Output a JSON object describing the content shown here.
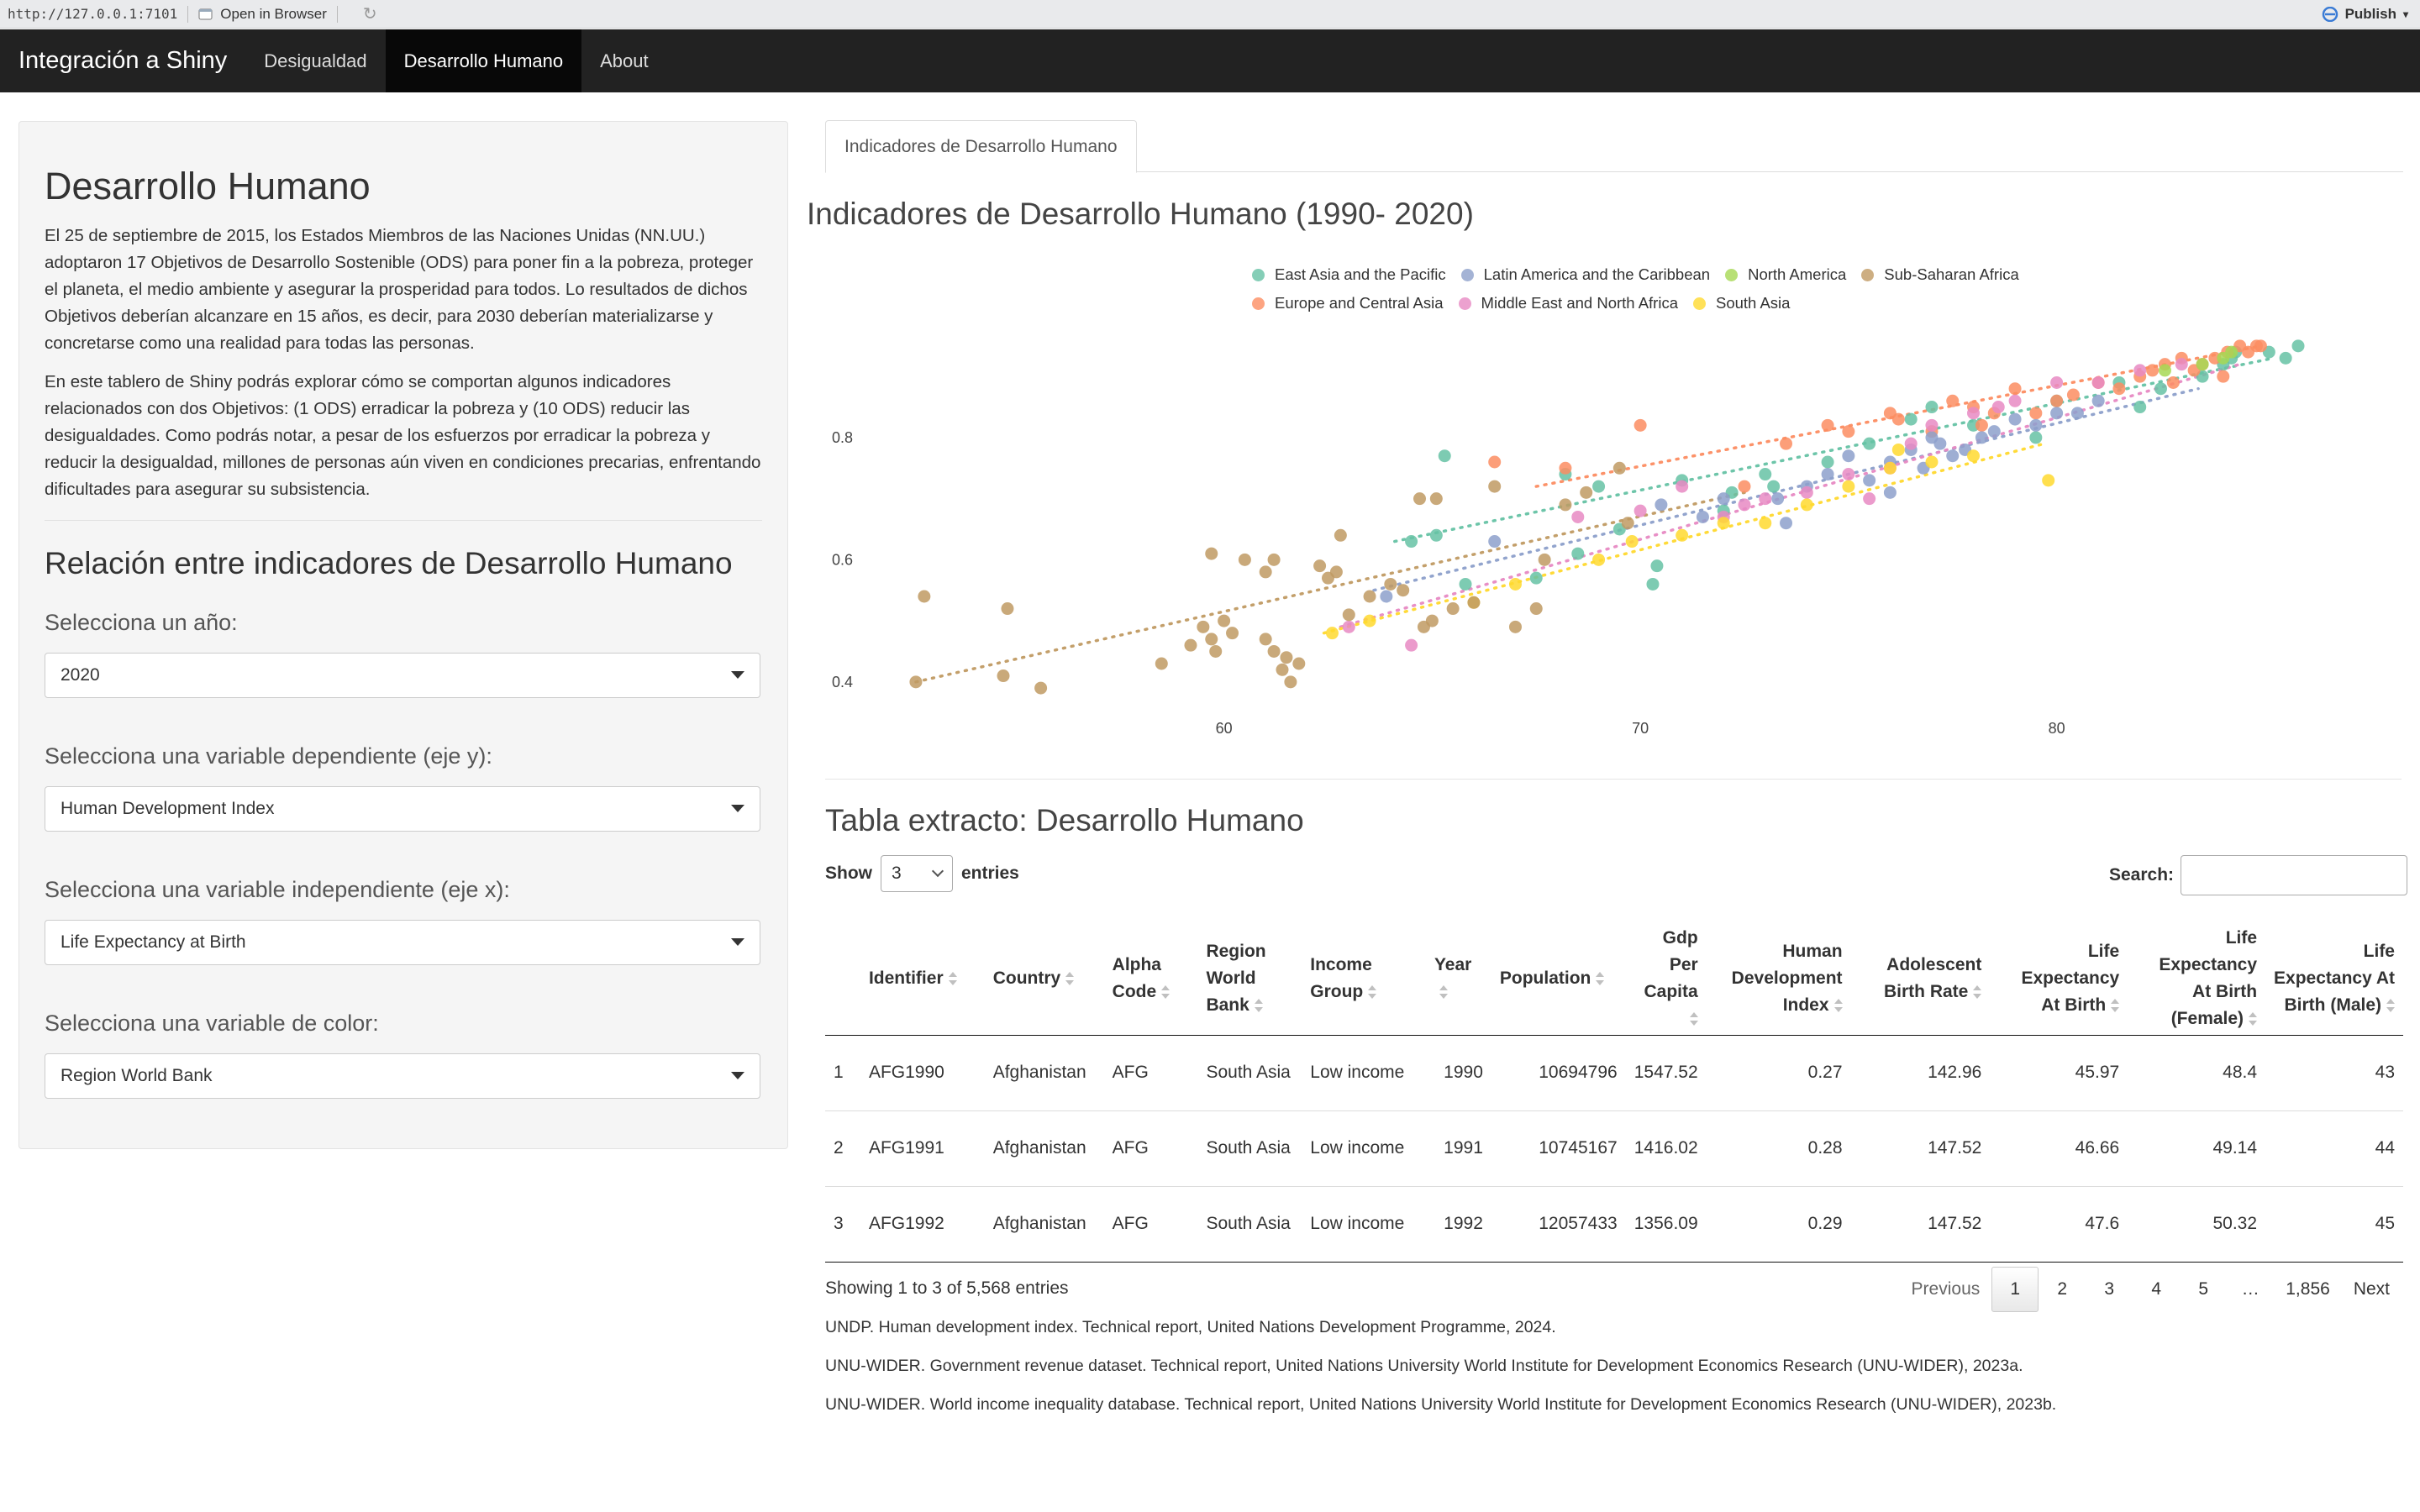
{
  "viewer": {
    "url": "http://127.0.0.1:7101",
    "open_label": "Open in Browser",
    "publish_label": "Publish"
  },
  "navbar": {
    "brand": "Integración a Shiny",
    "items": [
      {
        "label": "Desigualdad",
        "active": false
      },
      {
        "label": "Desarrollo Humano",
        "active": true
      },
      {
        "label": "About",
        "active": false
      }
    ]
  },
  "sidebar": {
    "title": "Desarrollo Humano",
    "para1": "El 25 de septiembre de 2015, los Estados Miembros de las Naciones Unidas (NN.UU.) adoptaron 17 Objetivos de Desarrollo Sostenible (ODS) para poner fin a la pobreza, proteger el planeta, el medio ambiente y asegurar la prosperidad para todos. Lo resultados de dichos Objetivos deberían alcanzare en 15 años, es decir, para 2030 deberían materializarse y concretarse como una realidad para todas las personas.",
    "para2": "En este tablero de Shiny podrás explorar cómo se comportan algunos indicadores relacionados con dos Objetivos: (1 ODS) erradicar la pobreza y (10 ODS) reducir las desigualdades. Como podrás notar, a pesar de los esfuerzos por erradicar la pobreza y reducir la desigualdad, millones de personas aún viven en condiciones precarias, enfrentando dificultades para asegurar su subsistencia.",
    "section_title": "Relación entre indicadores de Desarrollo Humano",
    "controls": [
      {
        "label": "Selecciona un año:",
        "value": "2020"
      },
      {
        "label": "Selecciona una variable dependiente (eje y):",
        "value": "Human Development Index"
      },
      {
        "label": "Selecciona una variable independiente (eje x):",
        "value": "Life Expectancy at Birth"
      },
      {
        "label": "Selecciona una variable de color:",
        "value": "Region World Bank"
      }
    ]
  },
  "main": {
    "tab_label": "Indicadores de Desarrollo Humano",
    "plot_title": "Indicadores de Desarrollo Humano (1990- 2020)",
    "table_title": "Tabla extracto: Desarrollo Humano",
    "show_label": "Show",
    "entries_value": "3",
    "entries_label": "entries",
    "search_label": "Search:",
    "info": "Showing 1 to 3 of 5,568 entries",
    "pager": [
      "Previous",
      "1",
      "2",
      "3",
      "4",
      "5",
      "…",
      "1,856",
      "Next"
    ],
    "references": [
      "UNDP. Human development index. Technical report, United Nations Development Programme, 2024.",
      "UNU-WIDER. Government revenue dataset. Technical report, United Nations University World Institute for Development Economics Research (UNU-WIDER), 2023a.",
      "UNU-WIDER. World income inequality database. Technical report, United Nations University World Institute for Development Economics Research (UNU-WIDER), 2023b."
    ]
  },
  "table": {
    "columns": [
      "",
      "Identifier",
      "Country",
      "Alpha Code",
      "Region World Bank",
      "Income Group",
      "Year",
      "Population",
      "Gdp Per Capita",
      "Human Development Index",
      "Adolescent Birth Rate",
      "Life Expectancy At Birth",
      "Life Expectancy At Birth (Female)",
      "Life Expectancy At Birth (Male)"
    ],
    "rows": [
      [
        "1",
        "AFG1990",
        "Afghanistan",
        "AFG",
        "South Asia",
        "Low income",
        "1990",
        "10694796",
        "1547.52",
        "0.27",
        "142.96",
        "45.97",
        "48.4",
        "43"
      ],
      [
        "2",
        "AFG1991",
        "Afghanistan",
        "AFG",
        "South Asia",
        "Low income",
        "1991",
        "10745167",
        "1416.02",
        "0.28",
        "147.52",
        "46.66",
        "49.14",
        "44"
      ],
      [
        "3",
        "AFG1992",
        "Afghanistan",
        "AFG",
        "South Asia",
        "Low income",
        "1992",
        "12057433",
        "1356.09",
        "0.29",
        "147.52",
        "47.6",
        "50.32",
        "45"
      ]
    ]
  },
  "chart_data": {
    "type": "scatter",
    "title": "Indicadores de Desarrollo Humano (1990- 2020)",
    "xlabel": "",
    "ylabel": "",
    "xlim": [
      52.5,
      85.8
    ],
    "ylim": [
      0.375,
      0.98
    ],
    "x_ticks": [
      60,
      70,
      80
    ],
    "y_ticks": [
      0.4,
      0.6,
      0.8
    ],
    "grid": false,
    "legend_position": "top",
    "series": [
      {
        "name": "East Asia and the Pacific",
        "color": "#66c2a5",
        "points": [
          [
            65.3,
            0.77
          ],
          [
            64.5,
            0.63
          ],
          [
            65.1,
            0.64
          ],
          [
            65.8,
            0.56
          ],
          [
            67.5,
            0.57
          ],
          [
            68.2,
            0.74
          ],
          [
            68.5,
            0.61
          ],
          [
            69,
            0.72
          ],
          [
            69.5,
            0.65
          ],
          [
            70.3,
            0.56
          ],
          [
            70.4,
            0.59
          ],
          [
            71,
            0.73
          ],
          [
            72.2,
            0.71
          ],
          [
            73,
            0.74
          ],
          [
            74.5,
            0.76
          ],
          [
            75.5,
            0.79
          ],
          [
            76.5,
            0.83
          ],
          [
            77,
            0.85
          ],
          [
            78,
            0.82
          ],
          [
            79.5,
            0.8
          ],
          [
            80,
            0.86
          ],
          [
            81.5,
            0.89
          ],
          [
            82.5,
            0.88
          ],
          [
            83.5,
            0.9
          ],
          [
            84,
            0.92
          ],
          [
            84.2,
            0.93
          ],
          [
            84.3,
            0.94
          ],
          [
            85.1,
            0.94
          ],
          [
            85.5,
            0.93
          ],
          [
            85.8,
            0.95
          ],
          [
            82,
            0.85
          ],
          [
            72,
            0.68
          ],
          [
            73.2,
            0.72
          ]
        ],
        "trend": [
          [
            64.1,
            0.63
          ],
          [
            85.2,
            0.93
          ]
        ]
      },
      {
        "name": "Europe and Central Asia",
        "color": "#fc8d62",
        "points": [
          [
            66.5,
            0.76
          ],
          [
            68.2,
            0.75
          ],
          [
            70,
            0.82
          ],
          [
            72.5,
            0.72
          ],
          [
            73.5,
            0.79
          ],
          [
            74.5,
            0.82
          ],
          [
            75,
            0.81
          ],
          [
            76,
            0.84
          ],
          [
            76.2,
            0.83
          ],
          [
            77,
            0.81
          ],
          [
            77.5,
            0.86
          ],
          [
            78,
            0.85
          ],
          [
            78.2,
            0.82
          ],
          [
            78.5,
            0.84
          ],
          [
            79,
            0.88
          ],
          [
            79.5,
            0.84
          ],
          [
            80,
            0.86
          ],
          [
            81,
            0.89
          ],
          [
            81.5,
            0.88
          ],
          [
            82,
            0.9
          ],
          [
            82.3,
            0.91
          ],
          [
            82.6,
            0.92
          ],
          [
            83,
            0.93
          ],
          [
            83.3,
            0.91
          ],
          [
            83.5,
            0.92
          ],
          [
            83.8,
            0.93
          ],
          [
            84.1,
            0.94
          ],
          [
            84.4,
            0.95
          ],
          [
            84.6,
            0.94
          ],
          [
            84.8,
            0.95
          ],
          [
            84.9,
            0.95
          ],
          [
            84,
            0.9
          ],
          [
            82.8,
            0.89
          ],
          [
            80.4,
            0.87
          ]
        ],
        "trend": [
          [
            67.5,
            0.72
          ],
          [
            84.9,
            0.95
          ]
        ]
      },
      {
        "name": "Latin America and the Caribbean",
        "color": "#8da0cb",
        "points": [
          [
            63.9,
            0.54
          ],
          [
            66.5,
            0.63
          ],
          [
            70.5,
            0.69
          ],
          [
            71.5,
            0.67
          ],
          [
            72,
            0.7
          ],
          [
            73.3,
            0.7
          ],
          [
            74,
            0.72
          ],
          [
            74.5,
            0.74
          ],
          [
            75,
            0.77
          ],
          [
            75.5,
            0.73
          ],
          [
            76,
            0.76
          ],
          [
            76.5,
            0.78
          ],
          [
            76.8,
            0.75
          ],
          [
            77,
            0.8
          ],
          [
            77.5,
            0.77
          ],
          [
            77.8,
            0.78
          ],
          [
            78.2,
            0.8
          ],
          [
            78.5,
            0.81
          ],
          [
            79,
            0.83
          ],
          [
            79.5,
            0.82
          ],
          [
            80,
            0.84
          ],
          [
            80.5,
            0.84
          ],
          [
            81,
            0.86
          ],
          [
            73.5,
            0.66
          ],
          [
            76,
            0.71
          ],
          [
            77.2,
            0.79
          ]
        ],
        "trend": [
          [
            63.6,
            0.55
          ],
          [
            83.4,
            0.88
          ]
        ]
      },
      {
        "name": "Middle East and North Africa",
        "color": "#e78ac3",
        "points": [
          [
            63,
            0.49
          ],
          [
            64.5,
            0.46
          ],
          [
            68.5,
            0.67
          ],
          [
            70,
            0.68
          ],
          [
            71,
            0.72
          ],
          [
            72,
            0.67
          ],
          [
            72.5,
            0.69
          ],
          [
            73,
            0.7
          ],
          [
            74,
            0.71
          ],
          [
            75,
            0.74
          ],
          [
            76,
            0.75
          ],
          [
            76.5,
            0.79
          ],
          [
            77,
            0.82
          ],
          [
            78,
            0.84
          ],
          [
            79,
            0.86
          ],
          [
            80,
            0.89
          ],
          [
            81,
            0.89
          ],
          [
            82,
            0.91
          ],
          [
            83,
            0.92
          ],
          [
            75.5,
            0.7
          ],
          [
            78.6,
            0.85
          ]
        ],
        "trend": [
          [
            62.8,
            0.49
          ],
          [
            84.4,
            0.92
          ]
        ]
      },
      {
        "name": "North America",
        "color": "#a6d854",
        "points": [
          [
            82.6,
            0.91
          ],
          [
            83.5,
            0.92
          ],
          [
            84,
            0.93
          ],
          [
            84.2,
            0.94
          ]
        ],
        "trend": []
      },
      {
        "name": "South Asia",
        "color": "#ffd92f",
        "points": [
          [
            62.6,
            0.48
          ],
          [
            63.5,
            0.5
          ],
          [
            66,
            0.53
          ],
          [
            67,
            0.56
          ],
          [
            69,
            0.6
          ],
          [
            69.8,
            0.63
          ],
          [
            71,
            0.64
          ],
          [
            72,
            0.66
          ],
          [
            73,
            0.66
          ],
          [
            74,
            0.69
          ],
          [
            75,
            0.72
          ],
          [
            76,
            0.75
          ],
          [
            77,
            0.76
          ],
          [
            78,
            0.77
          ],
          [
            79.8,
            0.73
          ],
          [
            76.2,
            0.78
          ]
        ],
        "trend": [
          [
            62.4,
            0.48
          ],
          [
            79.7,
            0.79
          ]
        ]
      },
      {
        "name": "Sub-Saharan Africa",
        "color": "#c09a63",
        "points": [
          [
            52.6,
            0.4
          ],
          [
            52.8,
            0.54
          ],
          [
            54.7,
            0.41
          ],
          [
            54.8,
            0.52
          ],
          [
            55.6,
            0.39
          ],
          [
            58.5,
            0.43
          ],
          [
            59.2,
            0.46
          ],
          [
            59.5,
            0.49
          ],
          [
            59.7,
            0.47
          ],
          [
            59.8,
            0.45
          ],
          [
            59.7,
            0.61
          ],
          [
            60,
            0.5
          ],
          [
            60.2,
            0.48
          ],
          [
            60.5,
            0.6
          ],
          [
            61,
            0.58
          ],
          [
            61.2,
            0.6
          ],
          [
            61,
            0.47
          ],
          [
            61.2,
            0.45
          ],
          [
            61.5,
            0.44
          ],
          [
            61.4,
            0.42
          ],
          [
            61.6,
            0.4
          ],
          [
            61.8,
            0.43
          ],
          [
            62.3,
            0.59
          ],
          [
            62.5,
            0.57
          ],
          [
            62.7,
            0.58
          ],
          [
            62.8,
            0.64
          ],
          [
            63,
            0.51
          ],
          [
            63.5,
            0.54
          ],
          [
            64,
            0.56
          ],
          [
            64.3,
            0.55
          ],
          [
            64.8,
            0.49
          ],
          [
            65,
            0.5
          ],
          [
            64.7,
            0.7
          ],
          [
            65.1,
            0.7
          ],
          [
            65.5,
            0.52
          ],
          [
            66,
            0.53
          ],
          [
            66.5,
            0.72
          ],
          [
            67,
            0.49
          ],
          [
            67.5,
            0.52
          ],
          [
            67.7,
            0.6
          ],
          [
            68.2,
            0.69
          ],
          [
            68.7,
            0.71
          ],
          [
            69.5,
            0.75
          ],
          [
            69.7,
            0.66
          ]
        ],
        "trend": [
          [
            52.6,
            0.4
          ],
          [
            72.5,
            0.71
          ]
        ]
      }
    ]
  }
}
